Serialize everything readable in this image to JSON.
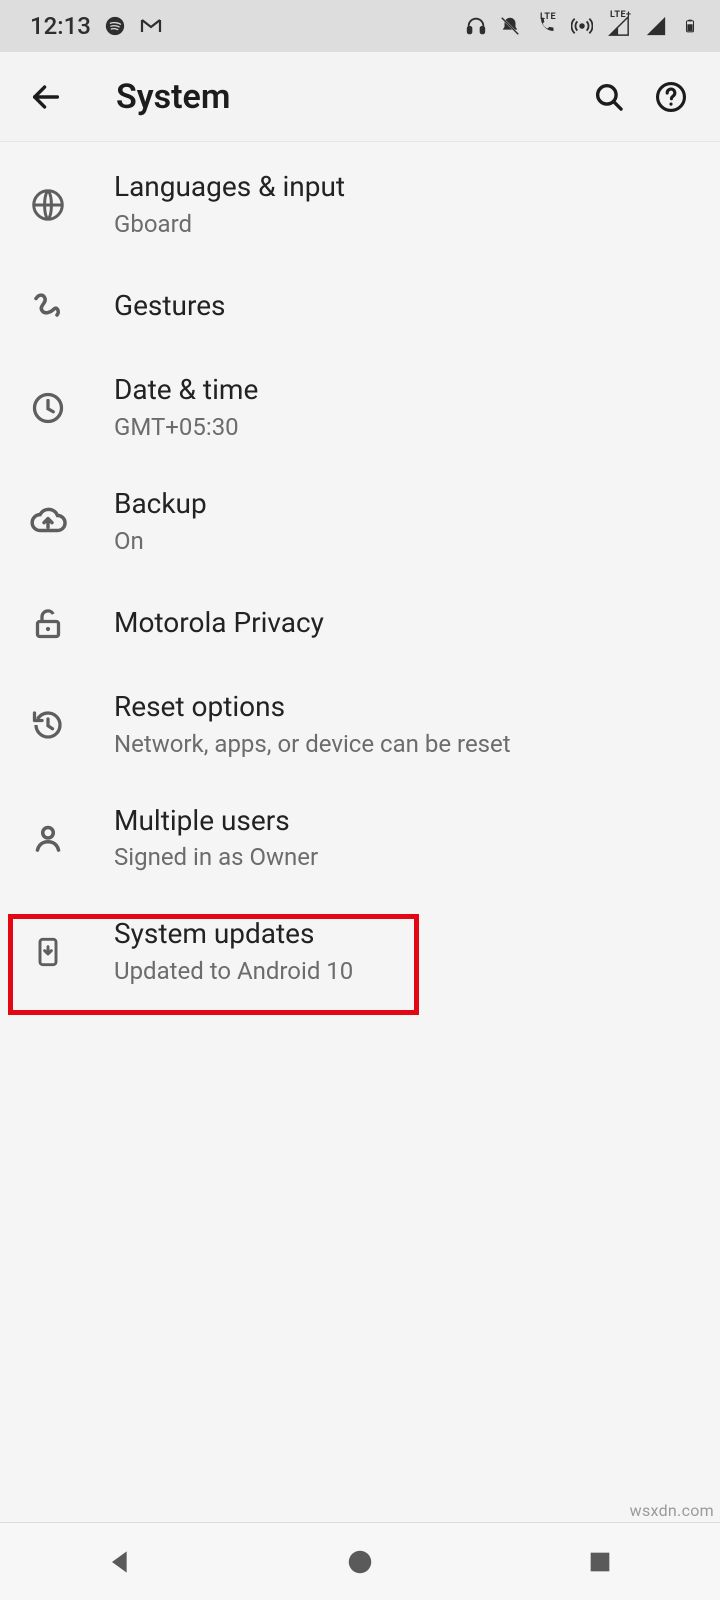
{
  "status_bar": {
    "time": "12:13",
    "icons": {
      "spotify": "spotify-icon",
      "gmail": "gmail-icon",
      "headphones": "headphones-icon",
      "dnd": "dnd-off-icon",
      "volte_call": "LTE",
      "hotspot": "hotspot-icon",
      "signal1_label": "LTE+",
      "battery": "battery-icon"
    }
  },
  "app_bar": {
    "title": "System",
    "back": "back",
    "search": "search",
    "help": "help"
  },
  "items": [
    {
      "id": "languages",
      "title": "Languages & input",
      "sub": "Gboard",
      "icon": "globe-icon"
    },
    {
      "id": "gestures",
      "title": "Gestures",
      "sub": "",
      "icon": "gesture-icon"
    },
    {
      "id": "datetime",
      "title": "Date & time",
      "sub": "GMT+05:30",
      "icon": "clock-icon"
    },
    {
      "id": "backup",
      "title": "Backup",
      "sub": "On",
      "icon": "cloud-upload-icon"
    },
    {
      "id": "privacy",
      "title": "Motorola Privacy",
      "sub": "",
      "icon": "unlock-icon"
    },
    {
      "id": "reset",
      "title": "Reset options",
      "sub": "Network, apps, or device can be reset",
      "icon": "restore-icon"
    },
    {
      "id": "multiuser",
      "title": "Multiple users",
      "sub": "Signed in as Owner",
      "icon": "person-icon"
    },
    {
      "id": "updates",
      "title": "System updates",
      "sub": "Updated to Android 10",
      "icon": "system-update-icon"
    }
  ],
  "nav": {
    "back": "nav-back",
    "home": "nav-home",
    "recent": "nav-recent"
  },
  "watermark": "wsxdn.com"
}
